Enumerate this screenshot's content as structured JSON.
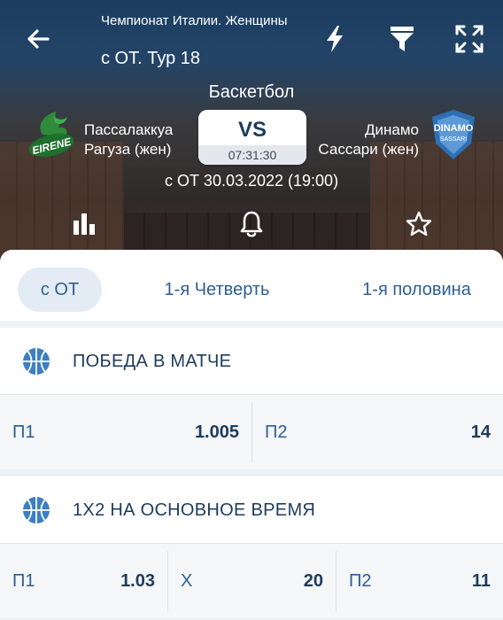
{
  "header": {
    "league": "Чемпионат Италии. Женщины",
    "round": "с ОТ. Тур 18",
    "sport": "Баскетбол",
    "match_date": "с ОТ 30.03.2022 (19:00)"
  },
  "match": {
    "team_left": {
      "name_line1": "Пассалаккуа",
      "name_line2": "Рагуза (жен)",
      "logo_text": "EIRENE"
    },
    "team_right": {
      "name_line1": "Динамо",
      "name_line2": "Сассари (жен)",
      "logo_text_1": "DINAMO",
      "logo_text_2": "SASSARI"
    },
    "vs": "VS",
    "countdown": "07:31:30"
  },
  "icons": {
    "back": "arrow-left-icon",
    "flash": "lightning-icon",
    "filter": "filter-icon",
    "fullscreen": "fullscreen-icon",
    "stats": "bar-chart-icon",
    "notify": "bell-icon",
    "favorite": "star-icon"
  },
  "tabs": [
    {
      "label": "с ОТ",
      "active": true
    },
    {
      "label": "1-я Четверть",
      "active": false
    },
    {
      "label": "1-я половина",
      "active": false
    }
  ],
  "markets": [
    {
      "title": "ПОБЕДА В МАТЧЕ",
      "odds": [
        {
          "label": "П1",
          "value": "1.005"
        },
        {
          "label": "П2",
          "value": "14"
        }
      ]
    },
    {
      "title": "1Х2 НА ОСНОВНОЕ ВРЕМЯ",
      "odds": [
        {
          "label": "П1",
          "value": "1.03"
        },
        {
          "label": "Х",
          "value": "20"
        },
        {
          "label": "П2",
          "value": "11"
        }
      ]
    }
  ],
  "colors": {
    "accent": "#2c5f93",
    "dark_text": "#1d3b5c",
    "tab_active_bg": "#e3ecf4",
    "ball_icon": "#3d7fc3"
  }
}
